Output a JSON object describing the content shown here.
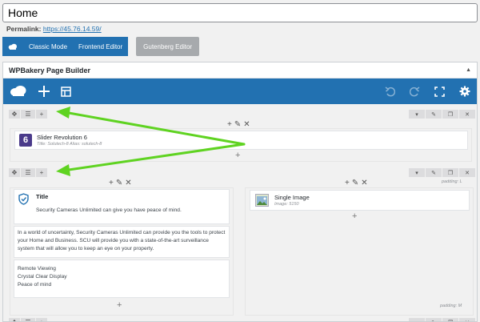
{
  "title": "Home",
  "permalink": {
    "label": "Permalink:",
    "url": "https://45.76.14.59/"
  },
  "buttons": {
    "classic_mode": "Classic Mode",
    "frontend_editor": "Frontend Editor",
    "gutenberg_editor": "Gutenberg Editor"
  },
  "builder": {
    "title": "WPBakery Page Builder",
    "toolbar_icons": [
      "cloud-logo-icon",
      "plus-icon",
      "layout-icon",
      "undo-icon",
      "redo-icon",
      "fullscreen-icon",
      "gear-icon"
    ]
  },
  "rows": [
    {
      "element": {
        "name": "Slider Revolution 6",
        "meta": "Title: Solutech-8  Alias: solutech-8"
      }
    },
    {
      "left": {
        "title_block": {
          "title": "Title",
          "text": "Security Cameras Unlimited can give you have peace of mind."
        },
        "paragraph": "In a world of uncertainty, Security Cameras Unlimited can provide you the tools to protect your Home and Business. SCU will provide you with a state-of-the-art surveillance system that will allow you to keep an eye on your property.",
        "features": [
          "Remote Viewing",
          "Crystal Clear Display",
          "Peace of mind"
        ]
      },
      "right": {
        "element": {
          "name": "Single Image",
          "meta": "Image: 5150"
        },
        "padding_top": "padding: L",
        "padding_bottom": "padding: M"
      }
    }
  ],
  "colors": {
    "accent": "#2271b1",
    "arrow": "#5fd321",
    "revslider": "#4a3a8a"
  }
}
